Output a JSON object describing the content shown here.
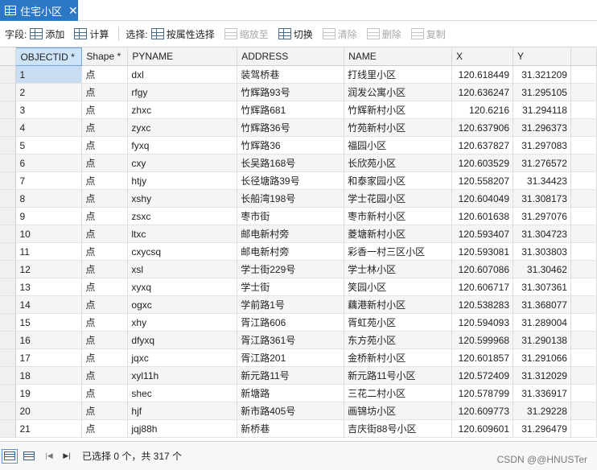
{
  "tab": {
    "title": "住宅小区",
    "close_glyph": "✕",
    "icon": "table-icon"
  },
  "toolbar": {
    "fields_label": "字段:",
    "add_label": "添加",
    "calculate_label": "计算",
    "selection_label": "选择:",
    "select_by_attributes_label": "按属性选择",
    "zoom_to_label": "缩放至",
    "switch_label": "切换",
    "clear_label": "清除",
    "delete_label": "删除",
    "copy_label": "复制"
  },
  "table": {
    "columns": [
      "OBJECTID *",
      "Shape *",
      "PYNAME",
      "ADDRESS",
      "NAME",
      "X",
      "Y"
    ],
    "rows": [
      [
        "1",
        "点",
        "dxl",
        "装驾桥巷",
        "打线里小区",
        "120.618449",
        "31.321209"
      ],
      [
        "2",
        "点",
        "rfgy",
        "竹辉路93号",
        "润发公寓小区",
        "120.636247",
        "31.295105"
      ],
      [
        "3",
        "点",
        "zhxc",
        "竹辉路681",
        "竹辉新村小区",
        "120.6216",
        "31.294118"
      ],
      [
        "4",
        "点",
        "zyxc",
        "竹辉路36号",
        "竹苑新村小区",
        "120.637906",
        "31.296373"
      ],
      [
        "5",
        "点",
        "fyxq",
        "竹辉路36",
        "福园小区",
        "120.637827",
        "31.297083"
      ],
      [
        "6",
        "点",
        "cxy",
        "长吴路168号",
        "长欣苑小区",
        "120.603529",
        "31.276572"
      ],
      [
        "7",
        "点",
        "htjy",
        "长径塘路39号",
        "和泰家园小区",
        "120.558207",
        "31.34423"
      ],
      [
        "8",
        "点",
        "xshy",
        "长船湾198号",
        "学士花园小区",
        "120.604049",
        "31.308173"
      ],
      [
        "9",
        "点",
        "zsxc",
        "枣市街",
        "枣市新村小区",
        "120.601638",
        "31.297076"
      ],
      [
        "10",
        "点",
        "ltxc",
        "邮电新村旁",
        "菱塘新村小区",
        "120.593407",
        "31.304723"
      ],
      [
        "11",
        "点",
        "cxycsq",
        "邮电新村旁",
        "彩香一村三区小区",
        "120.593081",
        "31.303803"
      ],
      [
        "12",
        "点",
        "xsl",
        "学士街229号",
        "学士林小区",
        "120.607086",
        "31.30462"
      ],
      [
        "13",
        "点",
        "xyxq",
        "学士街",
        "笑园小区",
        "120.606717",
        "31.307361"
      ],
      [
        "14",
        "点",
        "ogxc",
        "学前路1号",
        "藕港新村小区",
        "120.538283",
        "31.368077"
      ],
      [
        "15",
        "点",
        "xhy",
        "胥江路606",
        "胥虹苑小区",
        "120.594093",
        "31.289004"
      ],
      [
        "16",
        "点",
        "dfyxq",
        "胥江路361号",
        "东方苑小区",
        "120.599968",
        "31.290138"
      ],
      [
        "17",
        "点",
        "jqxc",
        "胥江路201",
        "金桥新村小区",
        "120.601857",
        "31.291066"
      ],
      [
        "18",
        "点",
        "xyl11h",
        "新元路11号",
        "新元路11号小区",
        "120.572409",
        "31.312029"
      ],
      [
        "19",
        "点",
        "shec",
        "新塘路",
        "三花二村小区",
        "120.578799",
        "31.336917"
      ],
      [
        "20",
        "点",
        "hjf",
        "新市路405号",
        "画锦坊小区",
        "120.609773",
        "31.29228"
      ],
      [
        "21",
        "点",
        "jqj88h",
        "新桥巷",
        "吉庆街88号小区",
        "120.609601",
        "31.296479"
      ]
    ]
  },
  "status": {
    "text": "已选择 0 个，共 317 个",
    "first_glyph": "|◀",
    "last_glyph": "▶|"
  },
  "watermark": "CSDN @@HNUSTer",
  "colors": {
    "tab_accent": "#2c78c5",
    "selected_cell": "#c8ddf2"
  }
}
